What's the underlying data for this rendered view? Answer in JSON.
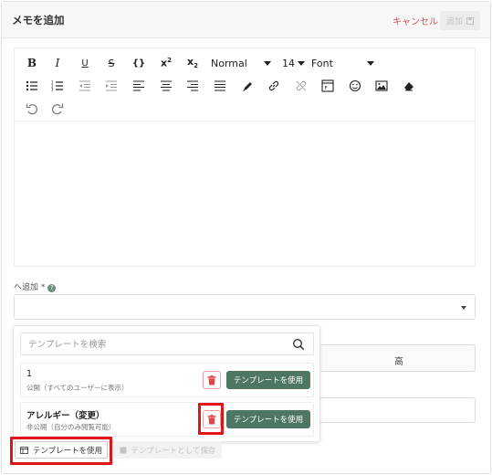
{
  "header": {
    "title": "メモを追加",
    "cancel_label": "キャンセル",
    "submit_label": "追加"
  },
  "toolbar": {
    "block_format": "Normal",
    "font_size": "14",
    "font_family": "Font",
    "tools_row1": [
      "bold-icon",
      "italic-icon",
      "underline-icon",
      "strikethrough-icon",
      "code-block-icon",
      "superscript-icon",
      "subscript-icon"
    ],
    "tools_row2": [
      "bullet-list-icon",
      "numbered-list-icon",
      "outdent-icon",
      "indent-icon",
      "align-left-icon",
      "align-center-icon",
      "align-right-icon",
      "justify-icon",
      "text-color-icon",
      "link-icon",
      "unlink-icon",
      "embed-icon",
      "emoji-icon",
      "image-icon",
      "clear-format-icon"
    ],
    "tools_row3": [
      "undo-icon",
      "redo-icon"
    ]
  },
  "add_to": {
    "label": "へ追加 *"
  },
  "behind": {
    "priority_high": "高"
  },
  "template_dropdown": {
    "search_placeholder": "テンプレートを検索",
    "items": [
      {
        "name": "1",
        "visibility": "公開（すべてのユーザーに表示）",
        "use_label": "テンプレートを使用"
      },
      {
        "name": "アレルギー（変更）",
        "visibility": "非公開（自分のみ閲覧可能）",
        "use_label": "テンプレートを使用"
      }
    ]
  },
  "footer": {
    "use_template_label": "テンプレートを使用",
    "save_template_label": "テンプレートとして保存"
  },
  "colors": {
    "accent_green": "#4e7763",
    "cancel_red": "#d9534f",
    "highlight_red": "#e0151b",
    "delete_red": "#e04545"
  }
}
